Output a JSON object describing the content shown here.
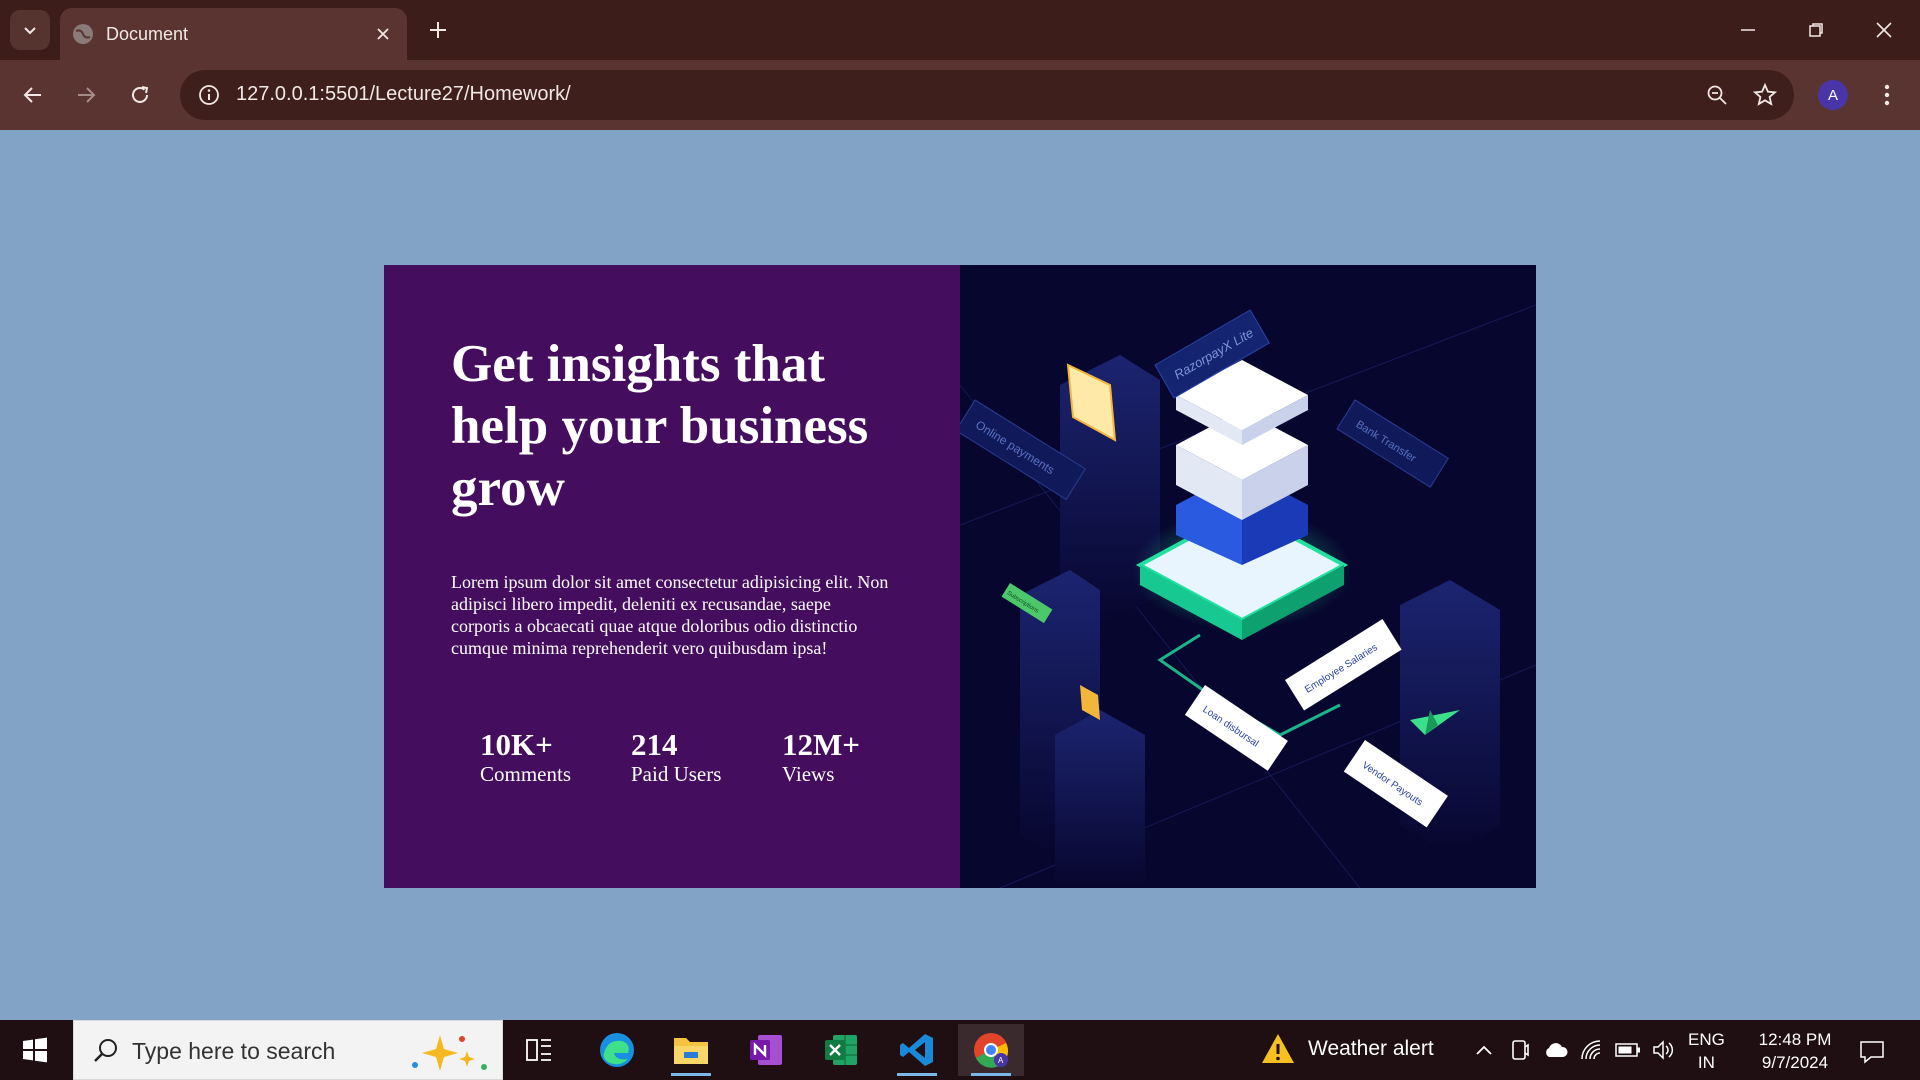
{
  "browser": {
    "tab_title": "Document",
    "url": "127.0.0.1:5501/Lecture27/Homework/",
    "profile_initial": "A"
  },
  "page": {
    "headline": "Get insights that help your business grow",
    "description": "Lorem ipsum dolor sit amet consectetur adipisicing elit. Non adipisci libero impedit, deleniti ex recusandae, saepe corporis a obcaecati quae atque doloribus odio distinctio cumque minima reprehenderit vero quibusdam ipsa!",
    "stats": [
      {
        "value": "10K+",
        "label": "Comments"
      },
      {
        "value": "214",
        "label": "Paid Users"
      },
      {
        "value": "12M+",
        "label": "Views"
      }
    ],
    "illustration_labels": {
      "top": "RazorpayX Lite",
      "left": "Online payments",
      "right": "Bank Transfer",
      "salaries": "Employee Salaries",
      "loan": "Loan disbursal",
      "vendor": "Vendor Payouts",
      "subscriptions": "Subscriptions"
    },
    "colors": {
      "page_bg": "#82a2c6",
      "card_left_bg": "#440d5d",
      "card_right_bg": "#07062e",
      "accent_green": "#22e0a0"
    }
  },
  "taskbar": {
    "search_placeholder": "Type here to search",
    "weather": "Weather alert",
    "lang_top": "ENG",
    "lang_bottom": "IN",
    "time": "12:48 PM",
    "date": "9/7/2024"
  }
}
